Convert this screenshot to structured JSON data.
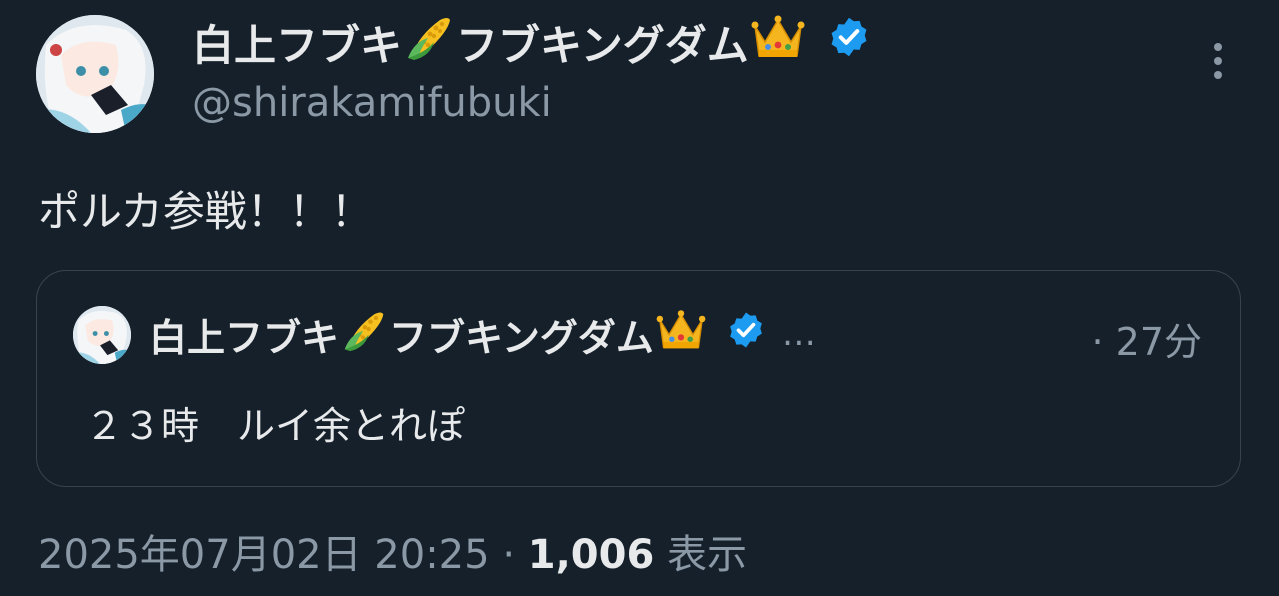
{
  "author": {
    "display_name_part1": "白上フブキ",
    "display_name_part2": "フブキングダム",
    "handle": "@shirakamifubuki",
    "emoji_after_part1": "corn-icon",
    "emoji_after_part2": "crown-icon",
    "verified_badge": "verified-badge-icon",
    "badge_color": "#1d9bf0"
  },
  "tweet": {
    "text": "ポルカ参戦！！！"
  },
  "quoted": {
    "display_name_part1": "白上フブキ",
    "display_name_part2": "フブキングダム",
    "ellipsis": "…",
    "time": "· 27分",
    "text": "２３時　ルイ余とれぽ"
  },
  "meta": {
    "timestamp": "2025年07月02日 20:25",
    "separator": "·",
    "views_count": "1,006",
    "views_label": "表示"
  },
  "colors": {
    "background": "#15202b",
    "primary_text": "#e7e9ea",
    "secondary_text": "#8b98a5",
    "border": "#38444d"
  }
}
